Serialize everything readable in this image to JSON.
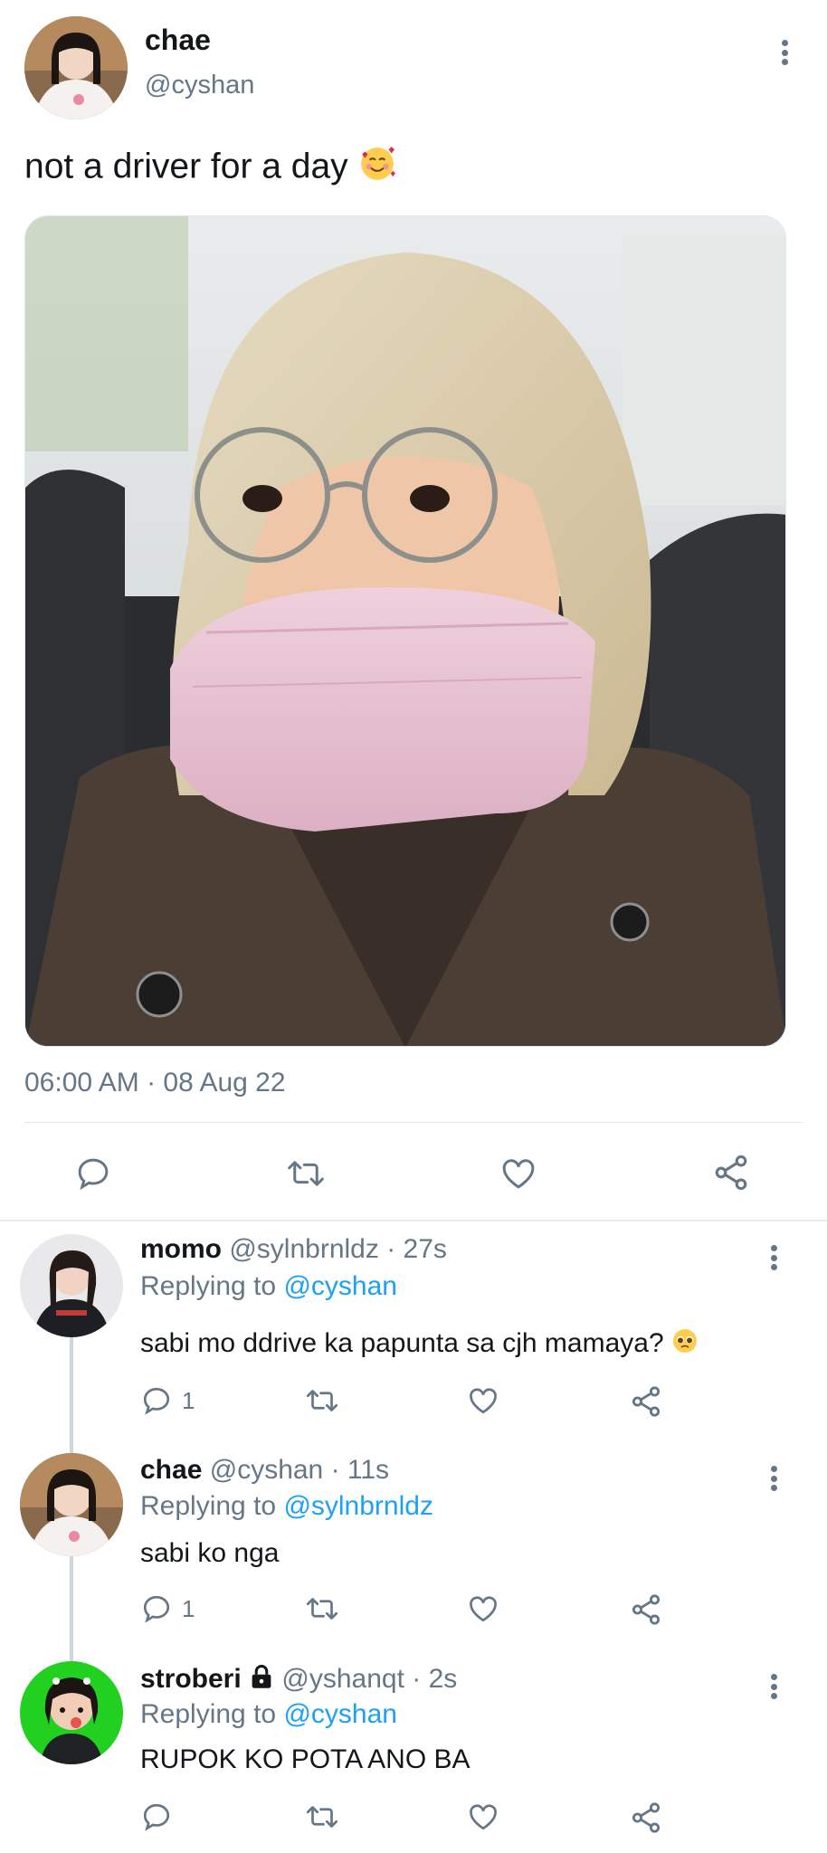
{
  "main_tweet": {
    "name": "chae",
    "handle": "@cyshan",
    "text": "not a driver for a day",
    "emoji": "smiling-face-with-hearts",
    "timestamp": "06:00 AM · 08 Aug 22"
  },
  "replies": [
    {
      "name": "momo",
      "handle": "@sylnbrnldz",
      "time": "· 27s",
      "replying_prefix": "Replying to",
      "replying_to": "@cyshan",
      "text": "sabi mo ddrive ka papunta sa cjh mamaya?",
      "emoji": "pleading-face",
      "reply_count": "1",
      "locked": false
    },
    {
      "name": "chae",
      "handle": "@cyshan",
      "time": "· 11s",
      "replying_prefix": "Replying to",
      "replying_to": "@sylnbrnldz",
      "text": "sabi ko nga",
      "reply_count": "1",
      "locked": false
    },
    {
      "name": "stroberi",
      "handle": "@yshanqt",
      "time": "· 2s",
      "replying_prefix": "Replying to",
      "replying_to": "@cyshan",
      "text": "RUPOK KO POTA ANO BA",
      "reply_count": "",
      "locked": true
    }
  ],
  "colors": {
    "accent": "#1da1f2",
    "secondary_text": "#657786",
    "primary_text": "#14171a",
    "divider": "#e1e8ed",
    "thread_line": "#ccd6dd",
    "highlight_avatar_bg": "#22d11f"
  },
  "icons": [
    "reply-icon",
    "retweet-icon",
    "like-icon",
    "share-icon",
    "more-options-icon",
    "lock-icon"
  ]
}
